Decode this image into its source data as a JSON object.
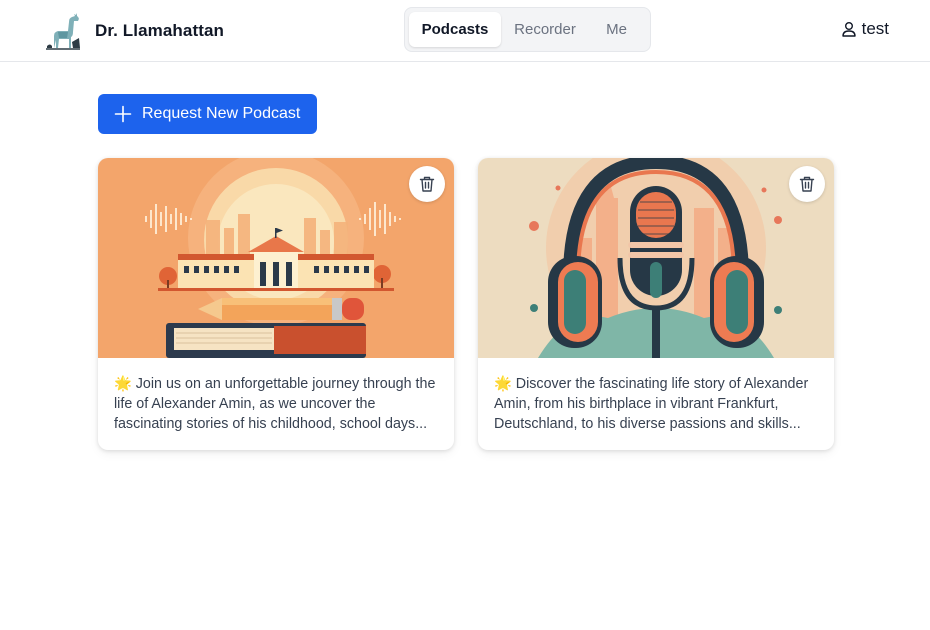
{
  "header": {
    "app_name": "Dr. Llamahattan",
    "logo_icon": "llama-logo-icon",
    "tabs": [
      {
        "label": "Podcasts",
        "active": true
      },
      {
        "label": "Recorder",
        "active": false
      },
      {
        "label": "Me",
        "active": false
      }
    ],
    "user": {
      "icon": "user-icon",
      "name": "test"
    }
  },
  "main": {
    "request_button": {
      "label": "Request New Podcast",
      "icon": "plus-icon"
    },
    "podcasts": [
      {
        "image": "school-books-illustration",
        "delete_icon": "trash-icon",
        "description": "🌟 Join us on an unforgettable journey through the life of Alexander Amin, as we uncover the fascinating stories of his childhood, school days..."
      },
      {
        "image": "headphones-microphone-illustration",
        "delete_icon": "trash-icon",
        "description": "🌟 Discover the fascinating life story of Alexander Amin, from his birthplace in vibrant Frankfurt, Deutschland, to his diverse passions and skills..."
      }
    ]
  },
  "colors": {
    "accent": "#1d63ed",
    "card1_bg": "#f3a56b",
    "card2_bg": "#eddcc0"
  }
}
